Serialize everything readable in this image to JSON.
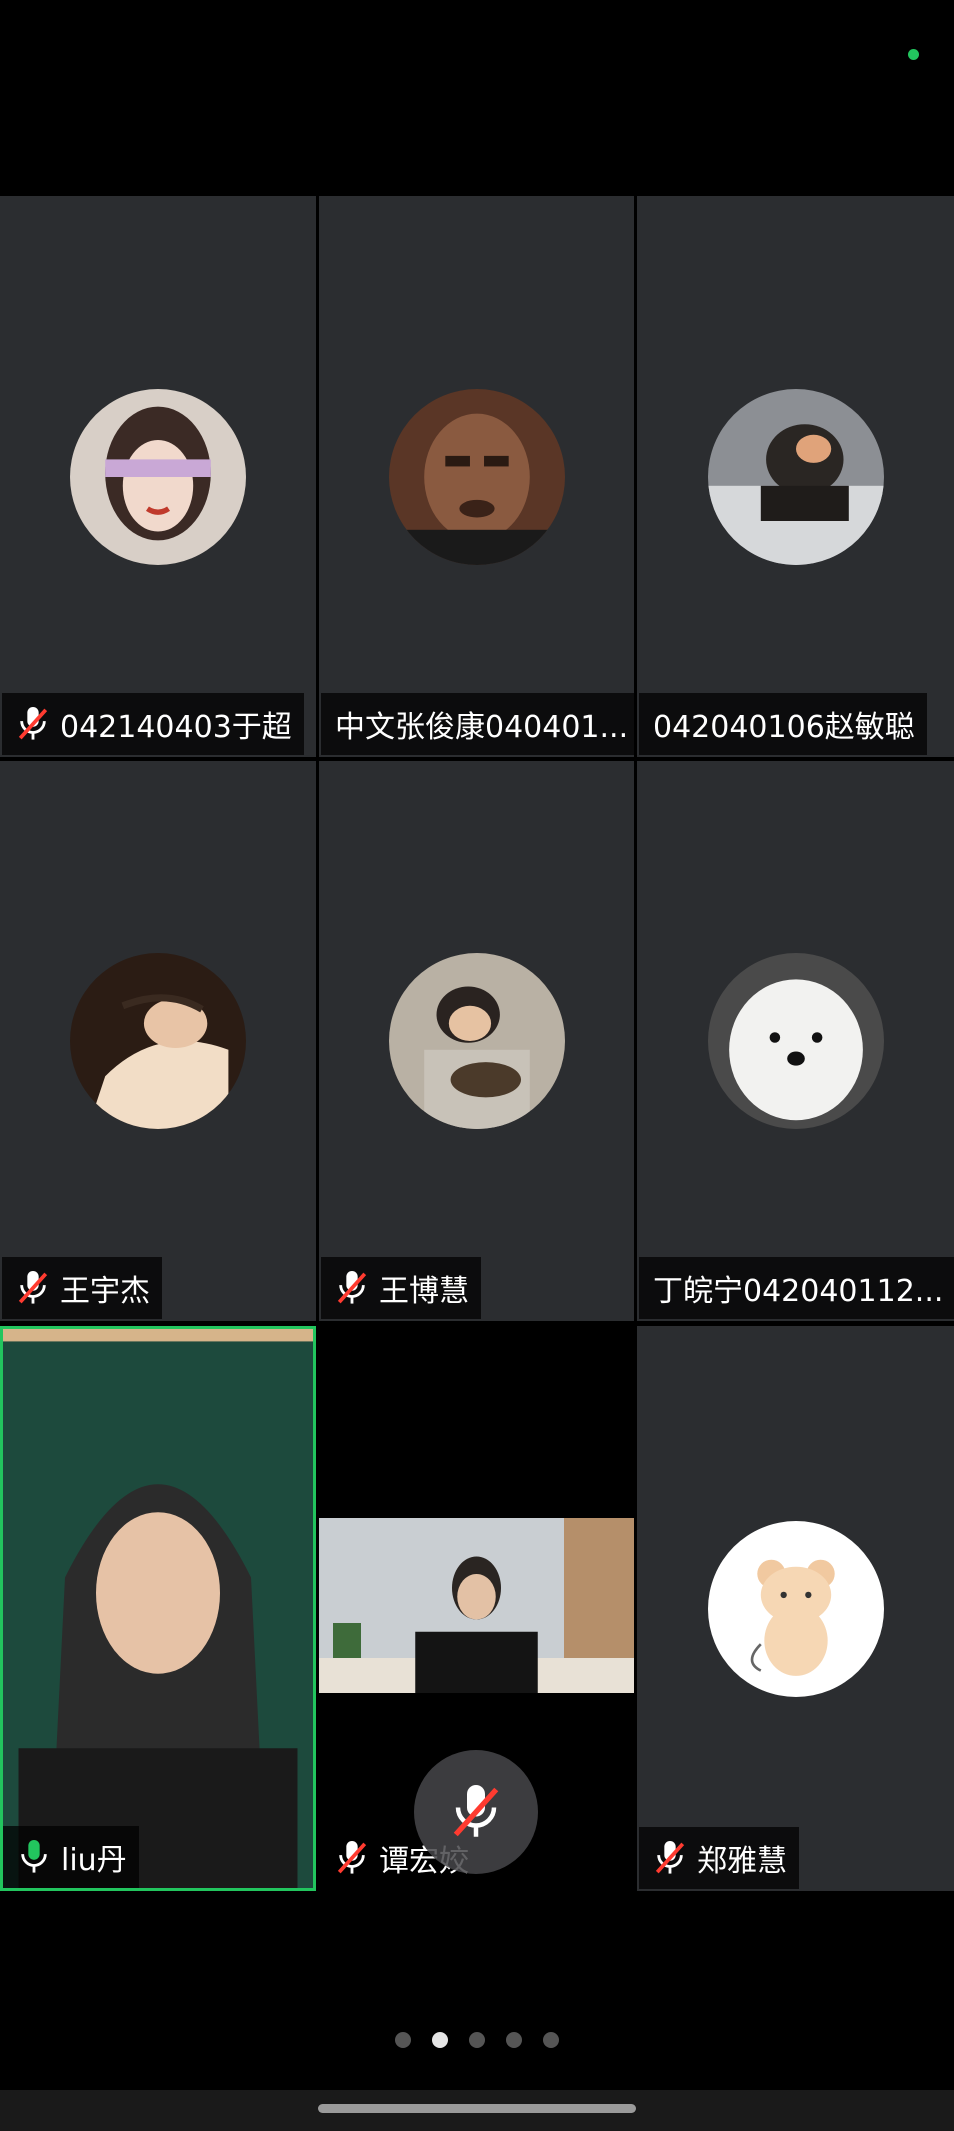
{
  "participants": [
    {
      "name": "042140403于超",
      "muted": true
    },
    {
      "name": "中文张俊康040401...",
      "muted": false
    },
    {
      "name": "042040106赵敏聪",
      "muted": false
    },
    {
      "name": "王宇杰",
      "muted": true
    },
    {
      "name": "王博慧",
      "muted": true
    },
    {
      "name": "丁皖宁042040112...",
      "muted": false
    },
    {
      "name": "liu丹",
      "muted": false,
      "speaking": true
    },
    {
      "name": "谭宏姣",
      "muted": true
    },
    {
      "name": "郑雅慧",
      "muted": true
    }
  ],
  "pager": {
    "total": 5,
    "active_index": 1
  },
  "colors": {
    "tile_bg": "#2b2d30",
    "active_speaker": "#22c55e",
    "muted_mic": "#ff3b30"
  }
}
